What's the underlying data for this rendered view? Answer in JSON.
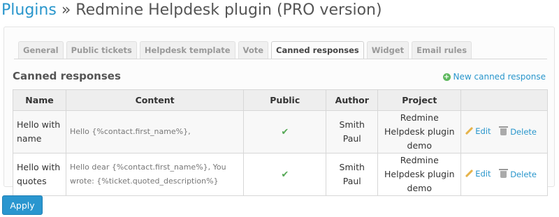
{
  "header": {
    "breadcrumb_link": "Plugins",
    "separator": "»",
    "title": "Redmine Helpdesk plugin (PRO version)"
  },
  "tabs": [
    {
      "label": "General",
      "selected": false
    },
    {
      "label": "Public tickets",
      "selected": false
    },
    {
      "label": "Helpdesk template",
      "selected": false
    },
    {
      "label": "Vote",
      "selected": false
    },
    {
      "label": "Canned responses",
      "selected": true
    },
    {
      "label": "Widget",
      "selected": false
    },
    {
      "label": "Email rules",
      "selected": false
    }
  ],
  "section": {
    "title": "Canned responses",
    "new_link": "New canned response"
  },
  "table": {
    "headers": {
      "name": "Name",
      "content": "Content",
      "public": "Public",
      "author": "Author",
      "project": "Project"
    },
    "rows": [
      {
        "name": "Hello with name",
        "content": "Hello {%contact.first_name%},",
        "public": true,
        "author": "Smith Paul",
        "project": "Redmine Helpdesk plugin demo",
        "edit": "Edit",
        "delete": "Delete"
      },
      {
        "name": "Hello with quotes",
        "content": "Hello dear {%contact.first_name%}, You wrote: {%ticket.quoted_description%}",
        "public": true,
        "author": "Smith Paul",
        "project": "Redmine Helpdesk plugin demo",
        "edit": "Edit",
        "delete": "Delete"
      }
    ]
  },
  "footer": {
    "apply_label": "Apply"
  },
  "colors": {
    "link": "#2996cc",
    "apply_button": "#2a96cf",
    "check": "#55a855"
  }
}
